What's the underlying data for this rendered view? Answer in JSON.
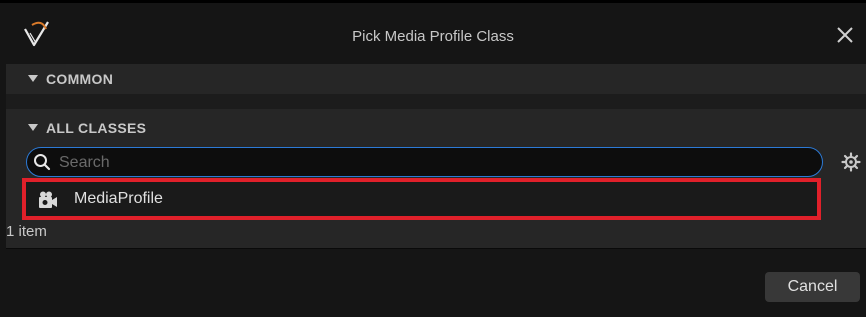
{
  "window": {
    "title": "Pick Media Profile Class",
    "close_icon": "close-icon",
    "logo_icon": "unreal-logo-icon"
  },
  "sections": {
    "common": {
      "label": "COMMON",
      "icon": "triangle-down-icon"
    },
    "all_classes": {
      "label": "ALL CLASSES",
      "icon": "triangle-down-icon"
    }
  },
  "search": {
    "placeholder": "Search",
    "value": "",
    "icon": "search-icon",
    "settings_icon": "gear-icon",
    "focus_color": "#2c7ad6"
  },
  "class_list": {
    "items": [
      {
        "label": "MediaProfile",
        "icon": "media-profile-icon",
        "selected": true
      }
    ],
    "count_text": "1 item",
    "highlight_color": "#e0202a"
  },
  "footer": {
    "cancel_label": "Cancel"
  },
  "colors": {
    "background": "#151515",
    "panel": "#262626",
    "text": "#c8c8c8"
  }
}
